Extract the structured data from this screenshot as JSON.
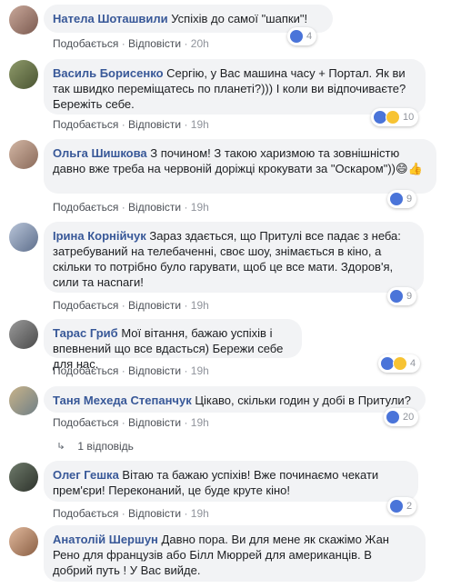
{
  "actions": {
    "like": "Подобається",
    "reply": "Відповісти",
    "sep": " · "
  },
  "comments": [
    {
      "name": "Натела Шоташвили",
      "text": "Успіхів до самої \"шапки\"!",
      "time": "20h",
      "reactions": [
        "like"
      ],
      "count": "4"
    },
    {
      "name": "Василь Борисенко",
      "text": "Сергію, у Вас машина часу + Портал. Як ви так швидко переміщатесь по планеті?))) І коли ви відпочиваєте? Бережіть себе.",
      "time": "19h",
      "reactions": [
        "like",
        "sad"
      ],
      "count": "10"
    },
    {
      "name": "Ольга Шишкова",
      "text": "З почином! З такою харизмою та зовнішністю давно вже треба на червоній доріжці крокувати за \"Оскаром\"))😄👍",
      "time": "19h",
      "reactions": [
        "like"
      ],
      "count": "9"
    },
    {
      "name": "Ірина Корнійчук",
      "text": "Зараз здається, що Притулі все падає з неба: затребуваний на телебаченні, своє шоу, знімається в кіно, а скільки то потрібно було гарувати, щоб це все мати. Здоров'я, сили та насnаги!",
      "time": "19h",
      "reactions": [
        "like"
      ],
      "count": "9"
    },
    {
      "name": "Тарас Гриб",
      "text": "Мої вітання, бажаю успіхів і впевнений що все вдасться) Бережи себе для нас.",
      "time": "19h",
      "reactions": [
        "like",
        "wow"
      ],
      "count": "4"
    },
    {
      "name": "Таня Меxеда Степанчук",
      "text": "Цікаво, скільки годин у добі в Притули?",
      "time": "19h",
      "reactions": [
        "like"
      ],
      "count": "20"
    },
    {
      "name": "Олег Гешка",
      "text": "Вітаю та бажаю успіхів! Вже починаємо чекати прем'єри! Переконаний, це буде круте кіно!",
      "time": "19h",
      "reactions": [
        "like"
      ],
      "count": "2"
    },
    {
      "name": "Анатолій Шершун",
      "text": "Давно пора. Ви для мене як скажімо Жан Рено для французів або Білл Мюррей для американців. В добрий путь ! У Вас вийде.",
      "time": "",
      "reactions": [],
      "count": ""
    }
  ],
  "reply_link": "1 відповідь",
  "colors": {
    "name": "#385898",
    "bubble": "#f2f3f5",
    "like": "#4a74d9",
    "meta": "#90949c"
  }
}
